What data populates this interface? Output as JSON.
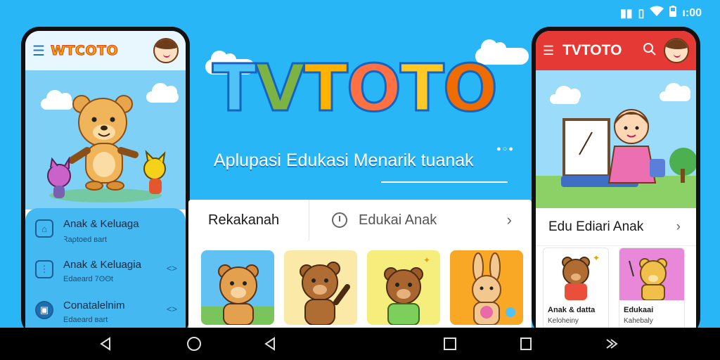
{
  "status_bar": {
    "time": "ı:00",
    "icons": [
      "sim-icon",
      "vibrate-icon",
      "wifi-icon",
      "battery-icon"
    ]
  },
  "left_phone": {
    "logo": "WTCOTO",
    "items": [
      {
        "title": "Anak & Keluaga",
        "subtitle": "Ꝛaρtoed ʙart",
        "icon": "home-icon"
      },
      {
        "title": "Anak & Keluagia",
        "subtitle": "Edaeard 7ʘʘt",
        "icon": "folder-icon"
      },
      {
        "title": "Conatalelnim",
        "subtitle": "Edaeard ʙart",
        "icon": "clipboard-icon"
      }
    ]
  },
  "center": {
    "logo_letters": [
      "T",
      "V",
      "T",
      "O",
      "T",
      "O"
    ],
    "tagline": "Aplupasi Edukasi Menarik tuanak",
    "tab_left": "Rekakanah",
    "tab_right": "Edukai Anak"
  },
  "right_phone": {
    "title": "TVTOTO",
    "section_title": "Edu Ediari Anak",
    "cards": [
      {
        "title": "Anak & datta",
        "subtitle": "Keloheiny"
      },
      {
        "title": "Edukaai",
        "subtitle": "Kahebaly"
      }
    ]
  },
  "colors": {
    "background": "#29b6f6",
    "accent_red": "#e53935",
    "logo_blue": "#1565c0"
  }
}
